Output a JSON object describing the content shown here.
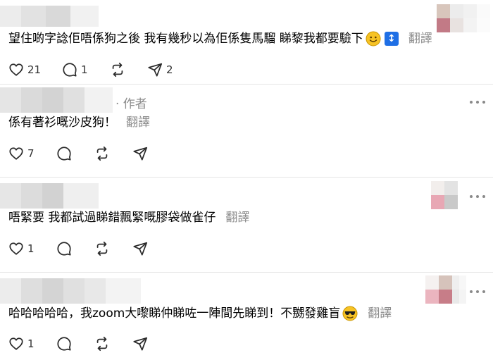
{
  "comments": [
    {
      "text": "望住啲字諗佢唔係狗之後 我有幾秒以為佢係隻馬騮 睇黎我都要驗下",
      "translate": "翻譯",
      "likes": "21",
      "replies": "1",
      "reposts": "",
      "shares": "2"
    },
    {
      "author_tag": "· 作者",
      "text": "係有著衫嘅沙皮狗！",
      "translate": "翻譯",
      "likes": "7",
      "replies": "",
      "reposts": "",
      "shares": ""
    },
    {
      "text": "唔緊要 我都試過睇錯飄緊嘅膠袋做雀仔",
      "translate": "翻譯",
      "likes": "1",
      "replies": "",
      "reposts": "",
      "shares": ""
    },
    {
      "text": "哈哈哈哈哈，我zoom大嚟睇仲睇咗一陣間先睇到！不嬲發雞盲",
      "translate": "翻譯",
      "likes": "1",
      "replies": "",
      "reposts": "",
      "shares": ""
    }
  ],
  "icons": {
    "like": "heart-icon",
    "reply": "comment-bubble-icon",
    "repost": "repost-icon",
    "share": "send-icon",
    "more": "more-dots-icon"
  },
  "colors": {
    "secondary_text": "#8c8c8c",
    "arrow_emoji_bg": "#1f6fe5"
  }
}
